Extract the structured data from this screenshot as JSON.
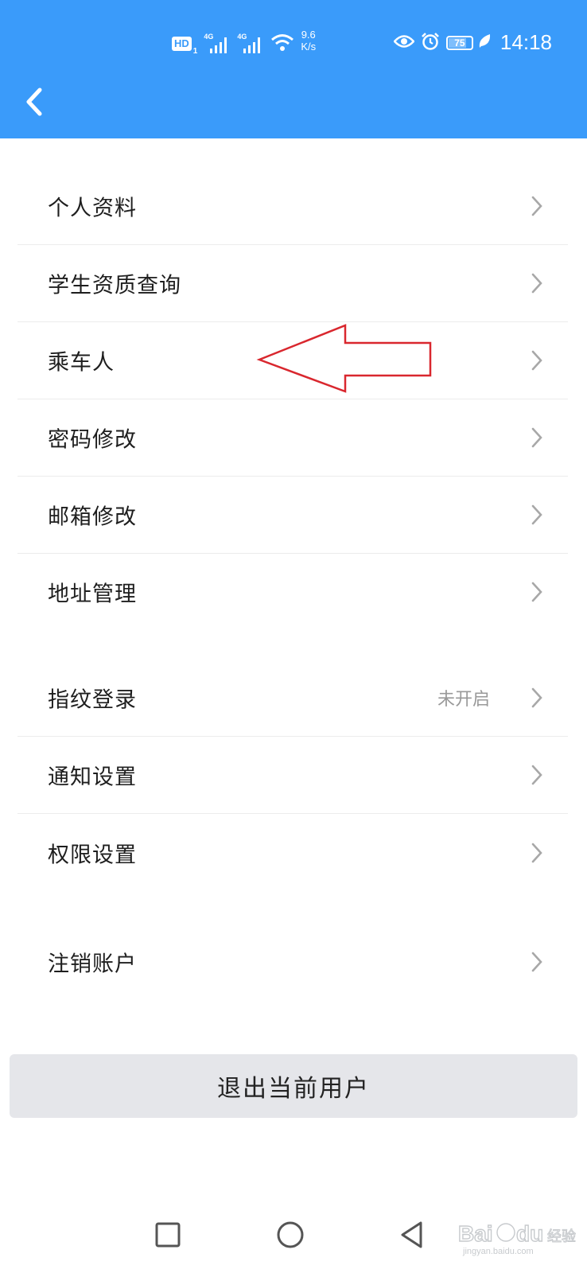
{
  "status_bar": {
    "hd_label": "HD",
    "hd_sub": "1",
    "signal1_gen": "4G",
    "signal2_gen": "4G",
    "net_speed_value": "9.6",
    "net_speed_unit": "K/s",
    "battery_level": "75",
    "time": "14:18",
    "icons": [
      "hd-icon",
      "signal-icon",
      "signal-icon",
      "wifi-icon",
      "eye-icon",
      "alarm-icon",
      "battery-icon",
      "leaf-icon"
    ]
  },
  "header": {
    "back_icon": "chevron-left-icon",
    "background_color": "#3a9bfa"
  },
  "menu": {
    "group1": [
      {
        "label": "个人资料"
      },
      {
        "label": "学生资质查询"
      },
      {
        "label": "乘车人"
      },
      {
        "label": "密码修改"
      },
      {
        "label": "邮箱修改"
      },
      {
        "label": "地址管理"
      }
    ],
    "group2": [
      {
        "label": "指纹登录",
        "value": "未开启"
      },
      {
        "label": "通知设置"
      },
      {
        "label": "权限设置"
      }
    ],
    "group3": [
      {
        "label": "注销账户"
      }
    ]
  },
  "annotation": {
    "type": "red-outline-arrow",
    "color": "#d9272e"
  },
  "logout": {
    "label": "退出当前用户"
  },
  "nav_bar": {
    "icons": [
      "square-recent-icon",
      "circle-home-icon",
      "triangle-back-icon"
    ]
  },
  "watermark": {
    "text": "Baidu经验",
    "subtext": "jingyan.baidu.com"
  }
}
